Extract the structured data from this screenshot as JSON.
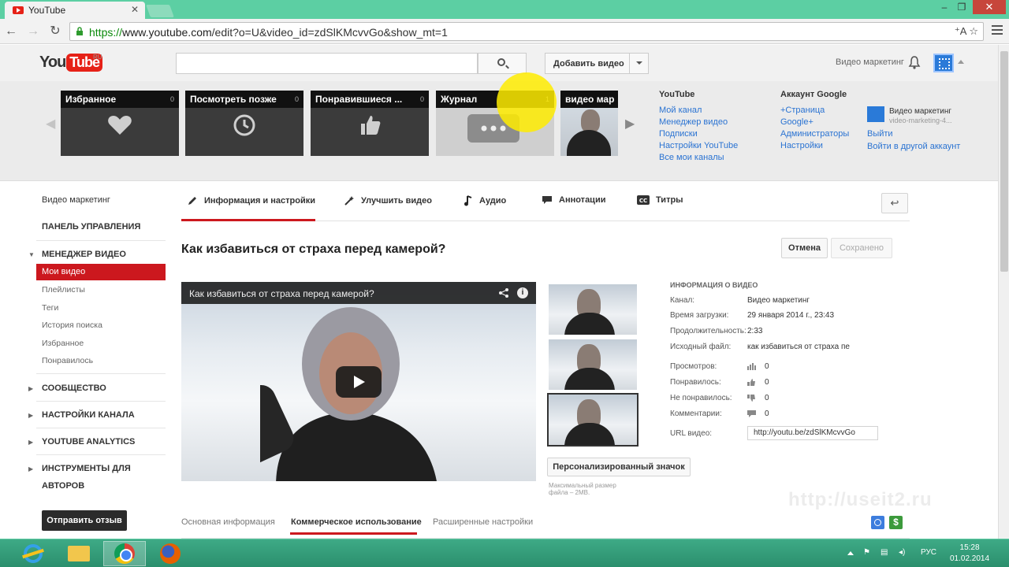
{
  "browser": {
    "tab_title": "YouTube",
    "url_scheme": "https://",
    "url_host": "www.youtube.com",
    "url_path": "/edit?o=U&video_id=zdSlKMcvvGo&show_mt=1"
  },
  "masthead": {
    "logo_you": "You",
    "logo_tube": "Tube",
    "logo_region": "RU",
    "search_placeholder": "",
    "upload_label": "Добавить видео",
    "channel_name": "Видео маркетинг"
  },
  "guide": {
    "playlists": [
      {
        "title": "Избранное",
        "count": "0"
      },
      {
        "title": "Посмотреть позже",
        "count": "0"
      },
      {
        "title": "Понравившиеся ...",
        "count": "0"
      },
      {
        "title": "Журнал",
        "count": "1"
      },
      {
        "title": "видео мар",
        "count": ""
      }
    ],
    "youtube_col": {
      "title": "YouTube",
      "links": [
        "Мой канал",
        "Менеджер видео",
        "Подписки",
        "Настройки YouTube",
        "Все мои каналы"
      ]
    },
    "google_col": {
      "title": "Аккаунт Google",
      "links": [
        "+Страница",
        "Google+",
        "Администраторы",
        "Настройки"
      ]
    },
    "account": {
      "name": "Видео маркетинг",
      "email": "video-marketing-4...",
      "logout": "Выйти",
      "switch": "Войти в другой аккаунт"
    }
  },
  "leftnav": {
    "channel": "Видео маркетинг",
    "dashboard": "ПАНЕЛЬ УПРАВЛЕНИЯ",
    "video_manager": "МЕНЕДЖЕР ВИДЕО",
    "active_item": "Мои видео",
    "sub_items": [
      "Плейлисты",
      "Теги",
      "История поиска",
      "Избранное",
      "Понравилось"
    ],
    "community": "СООБЩЕСТВО",
    "channel_settings": "НАСТРОЙКИ КАНАЛА",
    "analytics": "YOUTUBE ANALYTICS",
    "creator_tools_1": "ИНСТРУМЕНТЫ ДЛЯ",
    "creator_tools_2": "АВТОРОВ",
    "feedback": "Отправить отзыв"
  },
  "editor": {
    "tabs": [
      "Информация и настройки",
      "Улучшить видео",
      "Аудио",
      "Аннотации",
      "Титры"
    ],
    "back_icon": "↩",
    "title": "Как избавиться от страха перед камерой?",
    "cancel": "Отмена",
    "saved": "Сохранено",
    "player_title": "Как избавиться от страха перед камерой?",
    "custom_thumb_button": "Персонализированный значок",
    "thumb_note": "Максимальный размер файла – 2MB."
  },
  "video_info": {
    "heading": "ИНФОРМАЦИЯ О ВИДЕО",
    "channel_label": "Канал:",
    "channel_value": "Видео маркетинг",
    "uploaded_label": "Время загрузки:",
    "uploaded_value": "29 января 2014 г., 23:43",
    "duration_label": "Продолжительность:",
    "duration_value": "2:33",
    "source_label": "Исходный файл:",
    "source_value": "как избавиться от страха пе",
    "views_label": "Просмотров:",
    "views_value": "0",
    "likes_label": "Понравилось:",
    "likes_value": "0",
    "dislikes_label": "Не понравилось:",
    "dislikes_value": "0",
    "comments_label": "Комментарии:",
    "comments_value": "0",
    "url_label": "URL видео:",
    "url_value": "http://youtu.be/zdSlKMcvvGo"
  },
  "subtabs": [
    "Основная информация",
    "Коммерческое использование",
    "Расширенные настройки"
  ],
  "watermark": "http://useit2.ru",
  "taskbar": {
    "lang": "РУС",
    "time": "15:28",
    "date": "01.02.2014"
  }
}
